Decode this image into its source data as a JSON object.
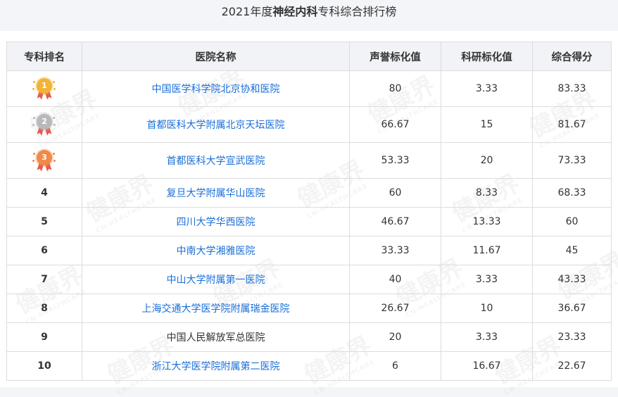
{
  "title": {
    "year": "2021年度",
    "specialty": "神经内科",
    "suffix": "专科综合排行榜"
  },
  "columns": [
    "专科排名",
    "医院名称",
    "声誉标化值",
    "科研标化值",
    "综合得分"
  ],
  "medal_colors": {
    "gold": "#f2b436",
    "silver": "#b9b9bd",
    "bronze": "#ef8a4a"
  },
  "rows": [
    {
      "rank": "1",
      "medal": "gold",
      "hospital": "中国医学科学院北京协和医院",
      "linked": true,
      "reputation": "80",
      "research": "3.33",
      "total": "83.33"
    },
    {
      "rank": "2",
      "medal": "silver",
      "hospital": "首都医科大学附属北京天坛医院",
      "linked": true,
      "reputation": "66.67",
      "research": "15",
      "total": "81.67"
    },
    {
      "rank": "3",
      "medal": "bronze",
      "hospital": "首都医科大学宣武医院",
      "linked": true,
      "reputation": "53.33",
      "research": "20",
      "total": "73.33"
    },
    {
      "rank": "4",
      "hospital": "复旦大学附属华山医院",
      "linked": true,
      "reputation": "60",
      "research": "8.33",
      "total": "68.33"
    },
    {
      "rank": "5",
      "hospital": "四川大学华西医院",
      "linked": true,
      "reputation": "46.67",
      "research": "13.33",
      "total": "60"
    },
    {
      "rank": "6",
      "hospital": "中南大学湘雅医院",
      "linked": true,
      "reputation": "33.33",
      "research": "11.67",
      "total": "45"
    },
    {
      "rank": "7",
      "hospital": "中山大学附属第一医院",
      "linked": true,
      "reputation": "40",
      "research": "3.33",
      "total": "43.33"
    },
    {
      "rank": "8",
      "hospital": "上海交通大学医学院附属瑞金医院",
      "linked": true,
      "reputation": "26.67",
      "research": "10",
      "total": "36.67"
    },
    {
      "rank": "9",
      "hospital": "中国人民解放军总医院",
      "linked": false,
      "reputation": "20",
      "research": "3.33",
      "total": "23.33"
    },
    {
      "rank": "10",
      "hospital": "浙江大学医学院附属第二医院",
      "linked": true,
      "reputation": "6",
      "research": "16.67",
      "total": "22.67"
    }
  ],
  "watermark": {
    "cn": "健康界",
    "en": "CN-HEALTHCARE"
  }
}
